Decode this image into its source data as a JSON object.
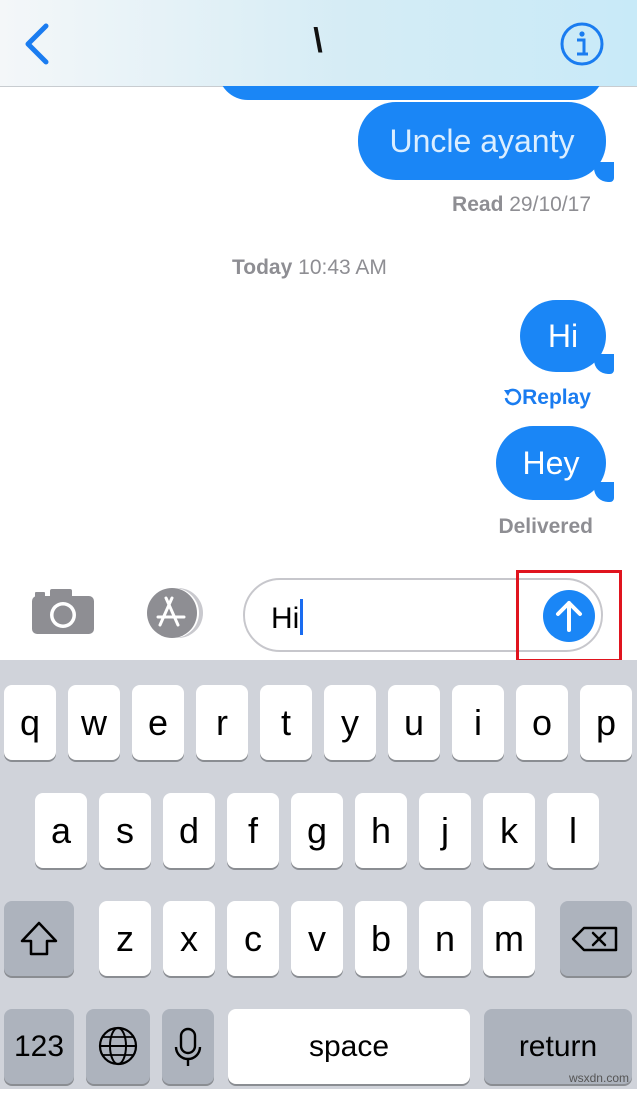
{
  "header": {
    "contact_name": "\\",
    "back_icon": "chevron-left-icon",
    "info_icon": "info-circle-icon"
  },
  "messages": {
    "old_message": "Uncle ayanty",
    "read_receipt_label": "Read",
    "read_receipt_date": "29/10/17",
    "time_label": "Today",
    "time_value": "10:43 AM",
    "msg_hi": "Hi",
    "replay_label": "Replay",
    "msg_hey": "Hey",
    "delivered": "Delivered"
  },
  "input": {
    "camera_icon": "camera-icon",
    "appstore_icon": "app-store-icon",
    "typed_text": "Hi",
    "send_icon": "arrow-up-icon"
  },
  "keyboard": {
    "row1": [
      "q",
      "w",
      "e",
      "r",
      "t",
      "y",
      "u",
      "i",
      "o",
      "p"
    ],
    "row2": [
      "a",
      "s",
      "d",
      "f",
      "g",
      "h",
      "j",
      "k",
      "l"
    ],
    "row3": [
      "z",
      "x",
      "c",
      "v",
      "b",
      "n",
      "m"
    ],
    "shift_icon": "shift-icon",
    "backspace_icon": "backspace-icon",
    "numbers_label": "123",
    "globe_icon": "globe-icon",
    "mic_icon": "microphone-icon",
    "space_label": "space",
    "return_label": "return"
  },
  "watermark": "wsxdn.com",
  "colors": {
    "bubble_blue": "#1a86f6",
    "highlight_red": "#e0141e",
    "keyboard_bg": "#d0d3da"
  }
}
